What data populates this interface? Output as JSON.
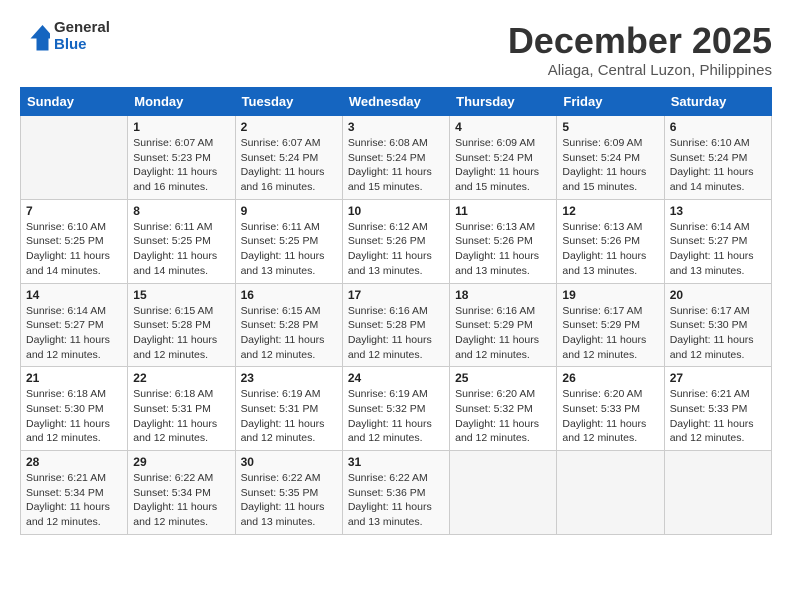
{
  "header": {
    "logo": {
      "general": "General",
      "blue": "Blue"
    },
    "title": "December 2025",
    "location": "Aliaga, Central Luzon, Philippines"
  },
  "days_of_week": [
    "Sunday",
    "Monday",
    "Tuesday",
    "Wednesday",
    "Thursday",
    "Friday",
    "Saturday"
  ],
  "weeks": [
    [
      {
        "day": "",
        "info": ""
      },
      {
        "day": "1",
        "info": "Sunrise: 6:07 AM\nSunset: 5:23 PM\nDaylight: 11 hours\nand 16 minutes."
      },
      {
        "day": "2",
        "info": "Sunrise: 6:07 AM\nSunset: 5:24 PM\nDaylight: 11 hours\nand 16 minutes."
      },
      {
        "day": "3",
        "info": "Sunrise: 6:08 AM\nSunset: 5:24 PM\nDaylight: 11 hours\nand 15 minutes."
      },
      {
        "day": "4",
        "info": "Sunrise: 6:09 AM\nSunset: 5:24 PM\nDaylight: 11 hours\nand 15 minutes."
      },
      {
        "day": "5",
        "info": "Sunrise: 6:09 AM\nSunset: 5:24 PM\nDaylight: 11 hours\nand 15 minutes."
      },
      {
        "day": "6",
        "info": "Sunrise: 6:10 AM\nSunset: 5:24 PM\nDaylight: 11 hours\nand 14 minutes."
      }
    ],
    [
      {
        "day": "7",
        "info": "Sunrise: 6:10 AM\nSunset: 5:25 PM\nDaylight: 11 hours\nand 14 minutes."
      },
      {
        "day": "8",
        "info": "Sunrise: 6:11 AM\nSunset: 5:25 PM\nDaylight: 11 hours\nand 14 minutes."
      },
      {
        "day": "9",
        "info": "Sunrise: 6:11 AM\nSunset: 5:25 PM\nDaylight: 11 hours\nand 13 minutes."
      },
      {
        "day": "10",
        "info": "Sunrise: 6:12 AM\nSunset: 5:26 PM\nDaylight: 11 hours\nand 13 minutes."
      },
      {
        "day": "11",
        "info": "Sunrise: 6:13 AM\nSunset: 5:26 PM\nDaylight: 11 hours\nand 13 minutes."
      },
      {
        "day": "12",
        "info": "Sunrise: 6:13 AM\nSunset: 5:26 PM\nDaylight: 11 hours\nand 13 minutes."
      },
      {
        "day": "13",
        "info": "Sunrise: 6:14 AM\nSunset: 5:27 PM\nDaylight: 11 hours\nand 13 minutes."
      }
    ],
    [
      {
        "day": "14",
        "info": "Sunrise: 6:14 AM\nSunset: 5:27 PM\nDaylight: 11 hours\nand 12 minutes."
      },
      {
        "day": "15",
        "info": "Sunrise: 6:15 AM\nSunset: 5:28 PM\nDaylight: 11 hours\nand 12 minutes."
      },
      {
        "day": "16",
        "info": "Sunrise: 6:15 AM\nSunset: 5:28 PM\nDaylight: 11 hours\nand 12 minutes."
      },
      {
        "day": "17",
        "info": "Sunrise: 6:16 AM\nSunset: 5:28 PM\nDaylight: 11 hours\nand 12 minutes."
      },
      {
        "day": "18",
        "info": "Sunrise: 6:16 AM\nSunset: 5:29 PM\nDaylight: 11 hours\nand 12 minutes."
      },
      {
        "day": "19",
        "info": "Sunrise: 6:17 AM\nSunset: 5:29 PM\nDaylight: 11 hours\nand 12 minutes."
      },
      {
        "day": "20",
        "info": "Sunrise: 6:17 AM\nSunset: 5:30 PM\nDaylight: 11 hours\nand 12 minutes."
      }
    ],
    [
      {
        "day": "21",
        "info": "Sunrise: 6:18 AM\nSunset: 5:30 PM\nDaylight: 11 hours\nand 12 minutes."
      },
      {
        "day": "22",
        "info": "Sunrise: 6:18 AM\nSunset: 5:31 PM\nDaylight: 11 hours\nand 12 minutes."
      },
      {
        "day": "23",
        "info": "Sunrise: 6:19 AM\nSunset: 5:31 PM\nDaylight: 11 hours\nand 12 minutes."
      },
      {
        "day": "24",
        "info": "Sunrise: 6:19 AM\nSunset: 5:32 PM\nDaylight: 11 hours\nand 12 minutes."
      },
      {
        "day": "25",
        "info": "Sunrise: 6:20 AM\nSunset: 5:32 PM\nDaylight: 11 hours\nand 12 minutes."
      },
      {
        "day": "26",
        "info": "Sunrise: 6:20 AM\nSunset: 5:33 PM\nDaylight: 11 hours\nand 12 minutes."
      },
      {
        "day": "27",
        "info": "Sunrise: 6:21 AM\nSunset: 5:33 PM\nDaylight: 11 hours\nand 12 minutes."
      }
    ],
    [
      {
        "day": "28",
        "info": "Sunrise: 6:21 AM\nSunset: 5:34 PM\nDaylight: 11 hours\nand 12 minutes."
      },
      {
        "day": "29",
        "info": "Sunrise: 6:22 AM\nSunset: 5:34 PM\nDaylight: 11 hours\nand 12 minutes."
      },
      {
        "day": "30",
        "info": "Sunrise: 6:22 AM\nSunset: 5:35 PM\nDaylight: 11 hours\nand 13 minutes."
      },
      {
        "day": "31",
        "info": "Sunrise: 6:22 AM\nSunset: 5:36 PM\nDaylight: 11 hours\nand 13 minutes."
      },
      {
        "day": "",
        "info": ""
      },
      {
        "day": "",
        "info": ""
      },
      {
        "day": "",
        "info": ""
      }
    ]
  ]
}
